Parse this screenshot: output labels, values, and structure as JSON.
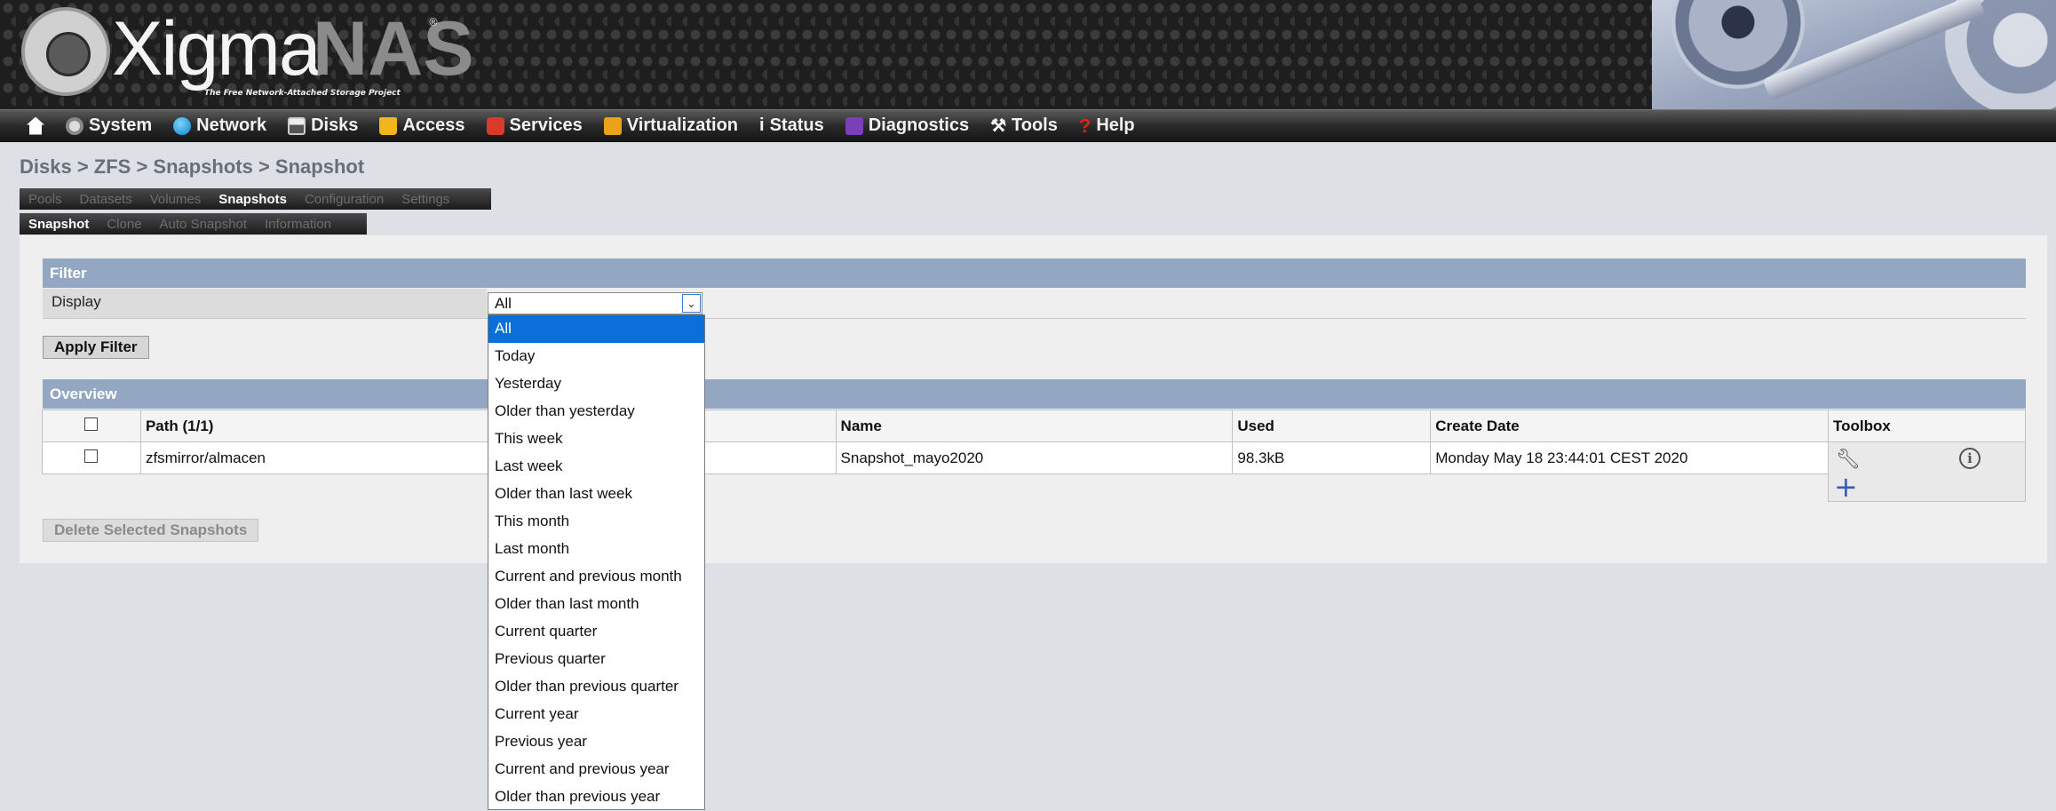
{
  "header": {
    "logo_main": "Xigma",
    "logo_accent": "NAS",
    "logo_reg": "®",
    "tagline": "The Free Network-Attached Storage Project"
  },
  "nav": [
    {
      "label": "",
      "icon": "home-icon"
    },
    {
      "label": "System",
      "icon": "gear-icon"
    },
    {
      "label": "Network",
      "icon": "globe-icon"
    },
    {
      "label": "Disks",
      "icon": "disk-icon"
    },
    {
      "label": "Access",
      "icon": "lock-icon"
    },
    {
      "label": "Services",
      "icon": "services-icon"
    },
    {
      "label": "Virtualization",
      "icon": "virtualization-icon"
    },
    {
      "label": "Status",
      "icon": "info-icon"
    },
    {
      "label": "Diagnostics",
      "icon": "diagnostics-icon"
    },
    {
      "label": "Tools",
      "icon": "tools-icon"
    },
    {
      "label": "Help",
      "icon": "help-icon"
    }
  ],
  "breadcrumb": "Disks > ZFS > Snapshots > Snapshot",
  "tabs_row1": [
    "Pools",
    "Datasets",
    "Volumes",
    "Snapshots",
    "Configuration",
    "Settings"
  ],
  "tabs_row1_active": "Snapshots",
  "tabs_row2": [
    "Snapshot",
    "Clone",
    "Auto Snapshot",
    "Information"
  ],
  "tabs_row2_active": "Snapshot",
  "filter": {
    "title": "Filter",
    "display_label": "Display",
    "selected": "All",
    "apply_button": "Apply Filter",
    "options": [
      "All",
      "Today",
      "Yesterday",
      "Older than yesterday",
      "This week",
      "Last week",
      "Older than last week",
      "This month",
      "Last month",
      "Current and previous month",
      "Older than last month",
      "Current quarter",
      "Previous quarter",
      "Older than previous quarter",
      "Current year",
      "Previous year",
      "Current and previous year",
      "Older than previous year"
    ]
  },
  "overview": {
    "title": "Overview",
    "columns": {
      "path": "Path (1/1)",
      "name": "Name",
      "used": "Used",
      "create_date": "Create Date",
      "toolbox": "Toolbox"
    },
    "rows": [
      {
        "path": "zfsmirror/almacen",
        "name": "Snapshot_mayo2020",
        "used": "98.3kB",
        "create_date": "Monday May 18 23:44:01 CEST 2020"
      }
    ],
    "delete_button": "Delete Selected Snapshots"
  }
}
